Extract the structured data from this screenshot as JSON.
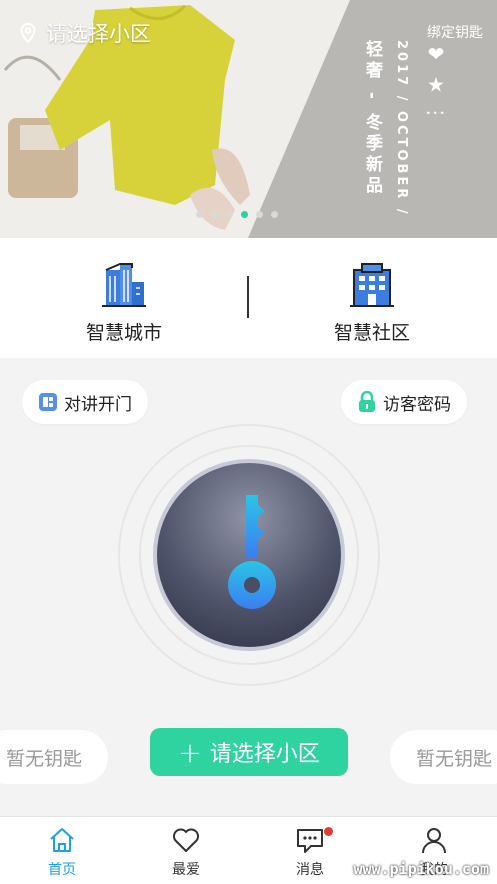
{
  "banner": {
    "location_label": "请选择小区",
    "bind_key_label": "绑定钥匙",
    "vertical_text_1": "轻奢 - 冬季新品",
    "vertical_text_2": "2017 / OCTOBER /",
    "decor_glyphs": "❤ ★ ⋮",
    "dots": [
      false,
      false,
      false,
      true,
      false,
      false
    ],
    "accent_color": "#2bd19f"
  },
  "categories": [
    {
      "label": "智慧城市",
      "icon": "city-buildings-icon"
    },
    {
      "label": "智慧社区",
      "icon": "community-building-icon"
    }
  ],
  "main": {
    "intercom_label": "对讲开门",
    "visitor_label": "访客密码",
    "left_key_label": "暂无钥匙",
    "right_key_label": "暂无钥匙",
    "select_button_label": "请选择小区",
    "select_button_plus": "+",
    "button_color": "#2ed3a0"
  },
  "tabbar": {
    "items": [
      {
        "label": "首页",
        "icon": "home-icon",
        "active": true
      },
      {
        "label": "最爱",
        "icon": "heart-icon",
        "active": false
      },
      {
        "label": "消息",
        "icon": "message-icon",
        "active": false,
        "badge": true
      },
      {
        "label": "我的",
        "icon": "user-icon",
        "active": false
      }
    ],
    "active_color": "#1ea0e6"
  },
  "watermark": "www.pipikou.com"
}
